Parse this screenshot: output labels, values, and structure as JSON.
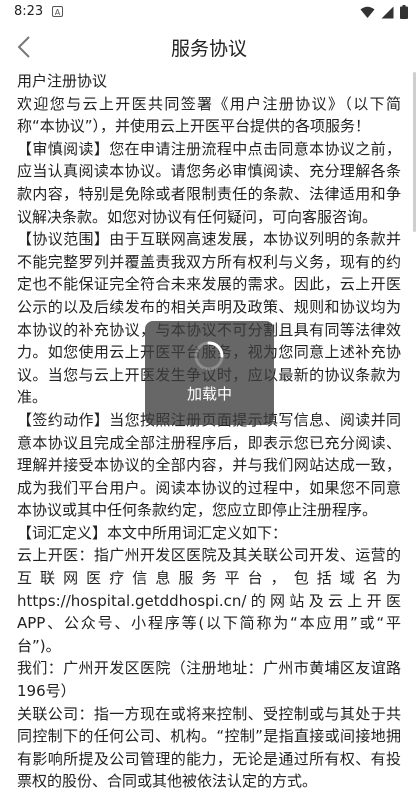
{
  "status_bar": {
    "time": "8:23",
    "notification_glyph": "A",
    "icons": [
      "wifi-icon",
      "signal-icon",
      "battery-icon"
    ]
  },
  "nav": {
    "back_icon": "chevron-left-icon",
    "title": "服务协议"
  },
  "agreement": {
    "heading": "用户注册协议",
    "paragraphs": [
      "欢迎您与云上开医共同签署《用户注册协议》（以下简称“本协议”），并使用云上开医平台提供的各项服务！",
      "【审慎阅读】您在申请注册流程中点击同意本协议之前，应当认真阅读本协议。请您务必审慎阅读、充分理解各条款内容，特别是免除或者限制责任的条款、法律适用和争议解决条款。如您对协议有任何疑问，可向客服咨询。",
      "【协议范围】由于互联网高速发展，本协议列明的条款并不能完整罗列并覆盖责我双方所有权利与义务，现有的约定也不能保证完全符合未来发展的需求。因此，云上开医公示的以及后续发布的相关声明及政策、规则和协议均为本协议的补充协议，与本协议不可分割且具有同等法律效力。如您使用云上开医平台服务，视为您同意上述补充协议。当您与云上开医发生争议时，应以最新的协议条款为准。",
      "【签约动作】当您按照注册页面提示填写信息、阅读并同意本协议且完成全部注册程序后，即表示您已充分阅读、理解并接受本协议的全部内容，并与我们网站达成一致，成为我们平台用户。阅读本协议的过程中，如果您不同意本协议或其中任何条款约定，您应立即停止注册程序。",
      "【词汇定义】本文中所用词汇定义如下：",
      "云上开医：指广州开发区医院及其关联公司开发、运营的互联网医疗信息服务平台，包括域名为https://hospital.getddhospi.cn/的网站及云上开医APP、公众号、小程序等(以下简称为“本应用”或“平台”)。",
      "我们：广州开发区医院（注册地址：广州市黄埔区友谊路196号）",
      "关联公司：指一方现在或将来控制、受控制或与其处于共同控制下的任何公司、机构。“控制”是指直接或间接地拥有影响所提及公司管理的能力，无论是通过所有权、有投票权的股份、合同或其他被依法认定的方式。"
    ]
  },
  "loading": {
    "text": "加载中"
  },
  "colors": {
    "text": "#222222",
    "overlay": "#3c3c3c",
    "background": "#ffffff"
  }
}
